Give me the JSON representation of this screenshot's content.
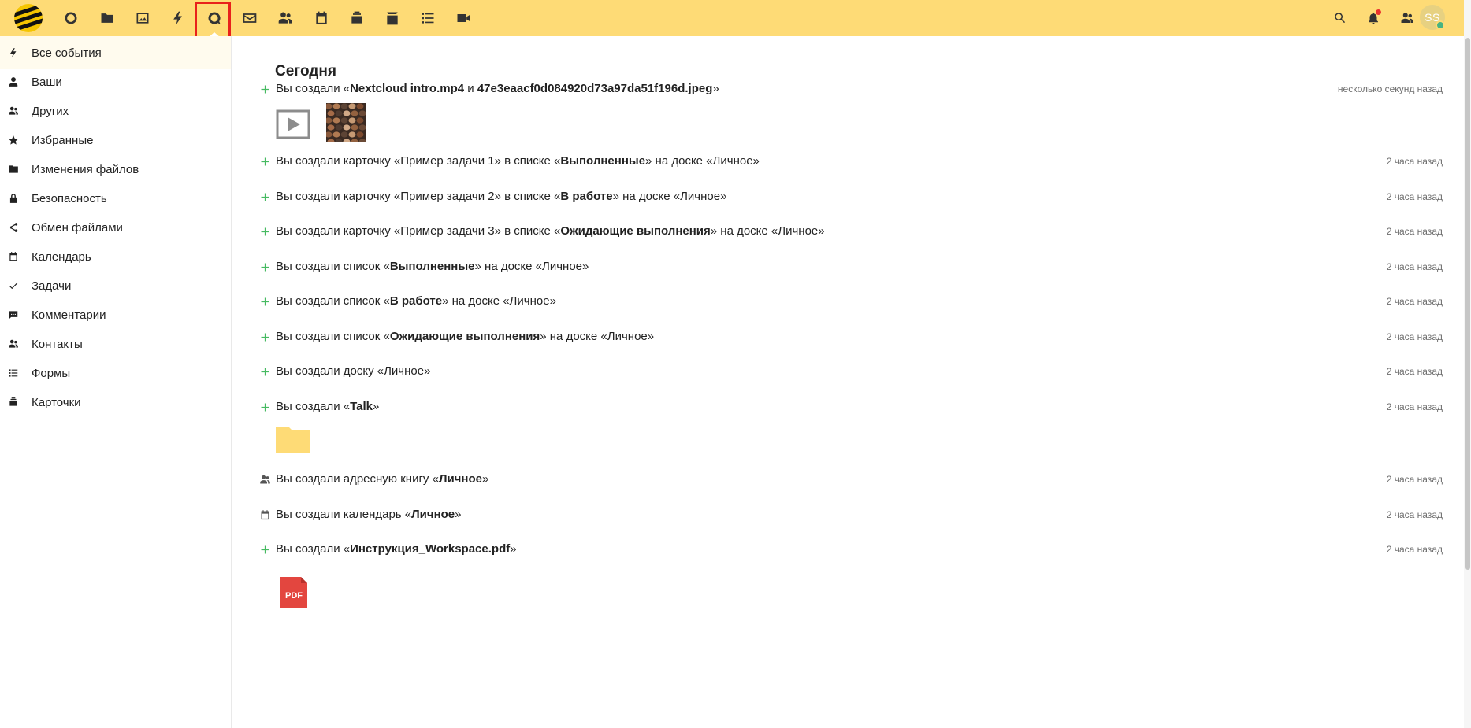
{
  "header": {
    "apps": [
      {
        "name": "dashboard-icon"
      },
      {
        "name": "files-icon"
      },
      {
        "name": "photos-icon"
      },
      {
        "name": "activity-icon"
      },
      {
        "name": "talk-icon"
      },
      {
        "name": "mail-icon"
      },
      {
        "name": "contacts-icon"
      },
      {
        "name": "calendar-icon"
      },
      {
        "name": "deck-icon"
      },
      {
        "name": "notes-icon"
      },
      {
        "name": "tasks-icon"
      },
      {
        "name": "video-icon"
      }
    ],
    "active_app": "activity",
    "avatar_initials": "SS",
    "accent_color": "#fedb76",
    "active_highlight_color": "#e8211b"
  },
  "sidebar": {
    "items": [
      {
        "label": "Все события",
        "icon": "lightning-icon",
        "active": true
      },
      {
        "label": "Ваши",
        "icon": "user-icon"
      },
      {
        "label": "Других",
        "icon": "users-icon"
      },
      {
        "label": "Избранные",
        "icon": "star-icon"
      },
      {
        "label": "Изменения файлов",
        "icon": "folder-icon"
      },
      {
        "label": "Безопасность",
        "icon": "lock-icon"
      },
      {
        "label": "Обмен файлами",
        "icon": "share-icon"
      },
      {
        "label": "Календарь",
        "icon": "calendar-icon"
      },
      {
        "label": "Задачи",
        "icon": "check-icon"
      },
      {
        "label": "Комментарии",
        "icon": "comment-icon"
      },
      {
        "label": "Контакты",
        "icon": "contacts-icon"
      },
      {
        "label": "Формы",
        "icon": "forms-icon"
      },
      {
        "label": "Карточки",
        "icon": "deck-icon"
      }
    ]
  },
  "main": {
    "section_title": "Сегодня",
    "activities": [
      {
        "icon": "plus-icon",
        "parts": [
          [
            "Вы создали «",
            false
          ],
          [
            "Nextcloud intro.mp4",
            true
          ],
          [
            " и ",
            false
          ],
          [
            "47e3eaacf0d084920d73a97da51f196d.jpeg",
            true
          ],
          [
            "»",
            false
          ]
        ],
        "time": "несколько секунд назад"
      },
      {
        "icon": "plus-icon",
        "parts": [
          [
            "Вы создали карточку «Пример задачи 1» в списке «",
            false
          ],
          [
            "Выполненные",
            true
          ],
          [
            "» на доске «Личное»",
            false
          ]
        ],
        "time": "2 часа назад"
      },
      {
        "icon": "plus-icon",
        "parts": [
          [
            "Вы создали карточку «Пример задачи 2» в списке «",
            false
          ],
          [
            "В работе",
            true
          ],
          [
            "» на доске «Личное»",
            false
          ]
        ],
        "time": "2 часа назад"
      },
      {
        "icon": "plus-icon",
        "parts": [
          [
            "Вы создали карточку «Пример задачи 3» в списке «",
            false
          ],
          [
            "Ожидающие выполнения",
            true
          ],
          [
            "» на доске «Личное»",
            false
          ]
        ],
        "time": "2 часа назад"
      },
      {
        "icon": "plus-icon",
        "parts": [
          [
            "Вы создали список «",
            false
          ],
          [
            "Выполненные",
            true
          ],
          [
            "» на доске «Личное»",
            false
          ]
        ],
        "time": "2 часа назад"
      },
      {
        "icon": "plus-icon",
        "parts": [
          [
            "Вы создали список «",
            false
          ],
          [
            "В работе",
            true
          ],
          [
            "» на доске «Личное»",
            false
          ]
        ],
        "time": "2 часа назад"
      },
      {
        "icon": "plus-icon",
        "parts": [
          [
            "Вы создали список «",
            false
          ],
          [
            "Ожидающие выполнения",
            true
          ],
          [
            "» на доске «Личное»",
            false
          ]
        ],
        "time": "2 часа назад"
      },
      {
        "icon": "plus-icon",
        "parts": [
          [
            "Вы создали доску «Личное»",
            false
          ]
        ],
        "time": "2 часа назад"
      },
      {
        "icon": "plus-icon",
        "parts": [
          [
            "Вы создали «",
            false
          ],
          [
            "Talk",
            true
          ],
          [
            "»",
            false
          ]
        ],
        "time": "2 часа назад"
      },
      {
        "icon": "contacts-icon",
        "parts": [
          [
            "Вы создали адресную книгу «",
            false
          ],
          [
            "Личное",
            true
          ],
          [
            "»",
            false
          ]
        ],
        "time": "2 часа назад"
      },
      {
        "icon": "calendar-icon",
        "parts": [
          [
            "Вы создали календарь «",
            false
          ],
          [
            "Личное",
            true
          ],
          [
            "»",
            false
          ]
        ],
        "time": "2 часа назад"
      },
      {
        "icon": "plus-icon",
        "parts": [
          [
            "Вы создали «",
            false
          ],
          [
            "Инструкция_Workspace.pdf",
            true
          ],
          [
            "»",
            false
          ]
        ],
        "time": "2 часа назад"
      }
    ],
    "pdf_label": "PDF"
  }
}
